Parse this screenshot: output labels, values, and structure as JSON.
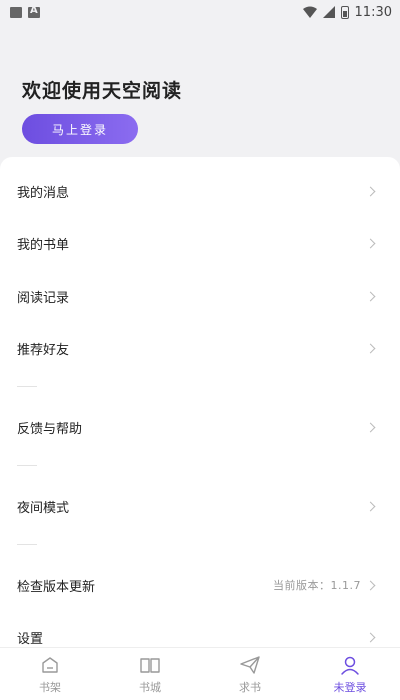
{
  "status_bar": {
    "time": "11:30",
    "left_icons": [
      "image-icon",
      "a-icon"
    ],
    "right_icons": [
      "wifi-icon",
      "cellular-icon",
      "battery-icon"
    ]
  },
  "header": {
    "welcome_text": "欢迎使用天空阅读",
    "login_label": "马上登录"
  },
  "menu": {
    "messages": "我的消息",
    "booklist": "我的书单",
    "history": "阅读记录",
    "recommend": "推荐好友",
    "feedback": "反馈与帮助",
    "night_mode": "夜间模式",
    "check_update": "检查版本更新",
    "current_version": "当前版本：1.1.7",
    "settings": "设置"
  },
  "bottom_nav": {
    "bookshelf": "书架",
    "bookstore": "书城",
    "request": "求书",
    "profile": "未登录"
  },
  "colors": {
    "accent": "#6d4ee0",
    "background": "#f1f1f3",
    "card": "#ffffff"
  }
}
